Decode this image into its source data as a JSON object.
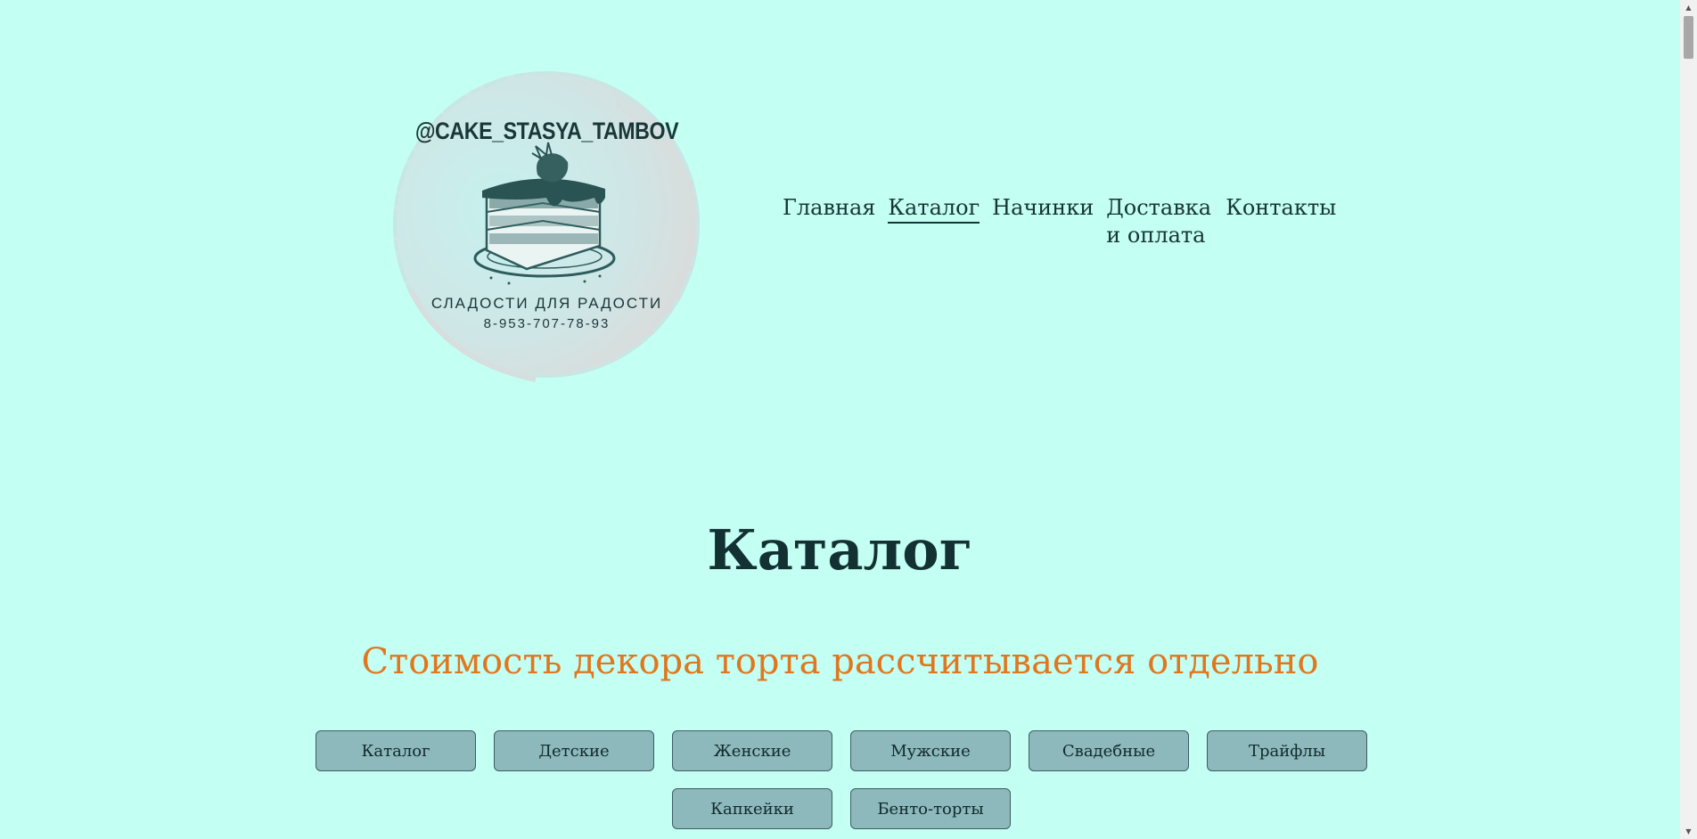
{
  "logo": {
    "handle": "@CAKE_STASYA_TAMBOV",
    "tagline": "СЛАДОСТИ ДЛЯ РАДОСТИ",
    "phone": "8-953-707-78-93",
    "image": "cake-slice-illustration"
  },
  "nav": {
    "items": [
      {
        "label": "Главная"
      },
      {
        "label": "Каталог",
        "active": true
      },
      {
        "label": "Начинки"
      },
      {
        "label": "Доставка и оплата"
      },
      {
        "label": "Контакты"
      }
    ]
  },
  "main": {
    "title": "Каталог",
    "notice": "Стоимость декора торта рассчитывается отдельно",
    "filters": [
      "Каталог",
      "Детские",
      "Женские",
      "Мужские",
      "Свадебные",
      "Трайфлы",
      "Капкейки",
      "Бенто-торты"
    ]
  },
  "colors": {
    "background": "#c3fff3",
    "accent": "#e0771f",
    "button": "#8db8bc",
    "text": "#133032"
  },
  "scrollbar": {
    "up_icon": "scroll-up-arrow",
    "down_icon": "scroll-down-arrow"
  }
}
